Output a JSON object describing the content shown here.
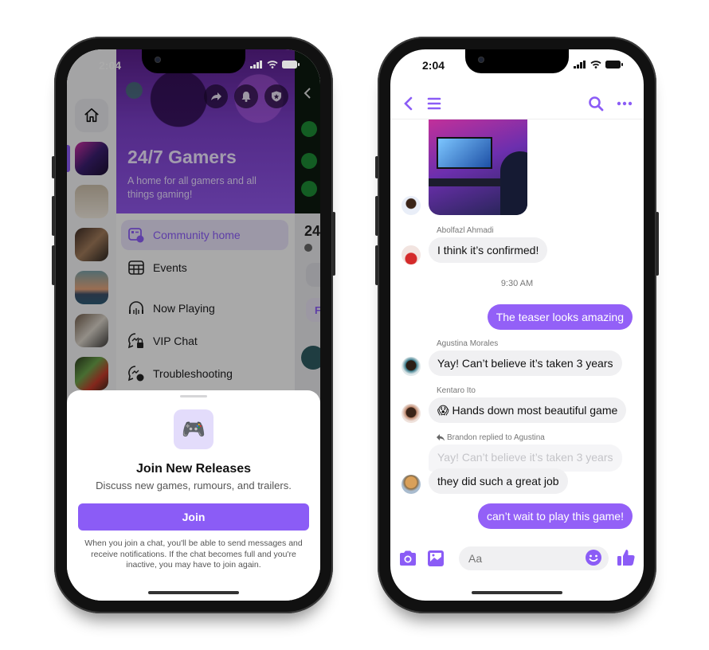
{
  "colors": {
    "accent": "#8b5cf6",
    "bubble_out": "#9360f7",
    "bubble_in": "#f0f0f2"
  },
  "left_phone": {
    "status_time": "2:04",
    "community": {
      "title": "24/7 Gamers",
      "description": "A home for all gamers and all things gaming!",
      "actions": [
        "share-icon",
        "bell-icon",
        "shield-icon"
      ]
    },
    "menu": [
      {
        "label": "Community home",
        "icon": "community-home-icon",
        "active": true
      },
      {
        "label": "Events",
        "icon": "calendar-icon"
      },
      {
        "label": "Now Playing",
        "icon": "headphones-icon"
      },
      {
        "label": "VIP Chat",
        "icon": "chat-lock-icon"
      },
      {
        "label": "Troubleshooting",
        "icon": "chat-globe-icon"
      }
    ],
    "peek": {
      "title": "24",
      "pill_letter": "F"
    },
    "sheet": {
      "icon": "🎮",
      "title": "Join New Releases",
      "subtitle": "Discuss new games, rumours, and trailers.",
      "join_label": "Join",
      "note": "When you join a chat, you'll be able to send messages and receive notifications. If the chat becomes full and you're inactive, you may have to join again."
    }
  },
  "right_phone": {
    "status_time": "2:04",
    "messages": [
      {
        "type": "image",
        "alt": "gaming setup photo"
      },
      {
        "type": "in",
        "sender": "Abolfazl Ahmadi",
        "text": "I think it’s confirmed!"
      },
      {
        "type": "timestamp",
        "text": "9:30 AM"
      },
      {
        "type": "out",
        "text": "The teaser looks amazing"
      },
      {
        "type": "in",
        "sender": "Agustina Morales",
        "text": "Yay! Can’t believe it’s taken 3 years"
      },
      {
        "type": "in",
        "sender": "Kentaro Ito",
        "text": "😱 Hands down most beautiful game"
      },
      {
        "type": "reply",
        "reply_label": "Brandon replied to Agustina",
        "quoted": "Yay! Can’t believe it’s taken 3 years",
        "text": "they did such a great job"
      },
      {
        "type": "out",
        "text": "can’t wait to play this game!"
      }
    ],
    "composer": {
      "placeholder": "Aa"
    }
  }
}
